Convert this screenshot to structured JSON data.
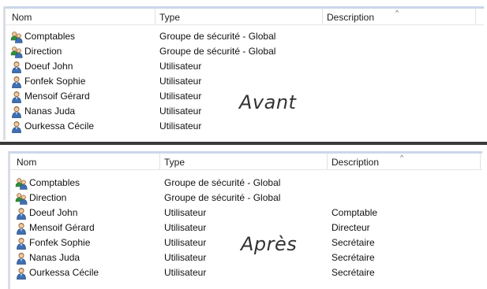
{
  "top": {
    "columns": {
      "name": "Nom",
      "type": "Type",
      "description": "Description"
    },
    "label": "Avant",
    "rows": [
      {
        "name": "Comptables",
        "type": "Groupe de sécurité - Global",
        "description": "",
        "icon": "group-icon"
      },
      {
        "name": "Direction",
        "type": "Groupe de sécurité - Global",
        "description": "",
        "icon": "group-icon"
      },
      {
        "name": "Doeuf John",
        "type": "Utilisateur",
        "description": "",
        "icon": "user-icon"
      },
      {
        "name": "Fonfek Sophie",
        "type": "Utilisateur",
        "description": "",
        "icon": "user-icon"
      },
      {
        "name": "Mensoif Gérard",
        "type": "Utilisateur",
        "description": "",
        "icon": "user-icon"
      },
      {
        "name": "Nanas Juda",
        "type": "Utilisateur",
        "description": "",
        "icon": "user-icon"
      },
      {
        "name": "Ourkessa Cécile",
        "type": "Utilisateur",
        "description": "",
        "icon": "user-icon"
      }
    ]
  },
  "bottom": {
    "columns": {
      "name": "Nom",
      "type": "Type",
      "description": "Description"
    },
    "label": "Après",
    "rows": [
      {
        "name": "Comptables",
        "type": "Groupe de sécurité - Global",
        "description": "",
        "icon": "group-icon"
      },
      {
        "name": "Direction",
        "type": "Groupe de sécurité - Global",
        "description": "",
        "icon": "group-icon"
      },
      {
        "name": "Doeuf John",
        "type": "Utilisateur",
        "description": "Comptable",
        "icon": "user-icon"
      },
      {
        "name": "Mensoif Gérard",
        "type": "Utilisateur",
        "description": "Directeur",
        "icon": "user-icon"
      },
      {
        "name": "Fonfek Sophie",
        "type": "Utilisateur",
        "description": "Secrétaire",
        "icon": "user-icon"
      },
      {
        "name": "Nanas Juda",
        "type": "Utilisateur",
        "description": "Secrétaire",
        "icon": "user-icon"
      },
      {
        "name": "Ourkessa Cécile",
        "type": "Utilisateur",
        "description": "Secrétaire",
        "icon": "user-icon"
      }
    ]
  },
  "colors": {
    "frame_blue": "#c9d7ea",
    "divider": "#3a3a3a"
  }
}
